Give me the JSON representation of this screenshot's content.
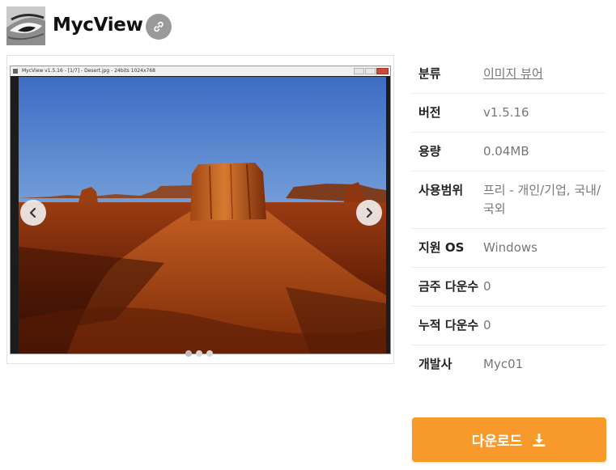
{
  "header": {
    "app_name": "MycView",
    "link_icon": "link-icon",
    "logo_icon": "eye-logo-icon"
  },
  "screenshot": {
    "window_title": "MycView v1.5.16 - [1/7] - Desert.jpg - 24bits  1024x768",
    "slides_count_dots": 3,
    "active_slide": 1
  },
  "info": {
    "category_label": "분류",
    "category_value": "이미지 뷰어",
    "version_label": "버전",
    "version_value": "v1.5.16",
    "size_label": "용량",
    "size_value": "0.04MB",
    "license_label": "사용범위",
    "license_value": "프리 - 개인/기업, 국내/국외",
    "os_label": "지원 OS",
    "os_value": "Windows",
    "weekly_label": "금주 다운수",
    "weekly_value": "0",
    "total_label": "누적 다운수",
    "total_value": "0",
    "developer_label": "개발사",
    "developer_value": "Myc01"
  },
  "download": {
    "label": "다운로드",
    "icon": "download-icon"
  },
  "colors": {
    "accent": "#f79a2b",
    "link_button": "#9a9a9a",
    "label_text": "#222222",
    "value_text": "#777777"
  }
}
